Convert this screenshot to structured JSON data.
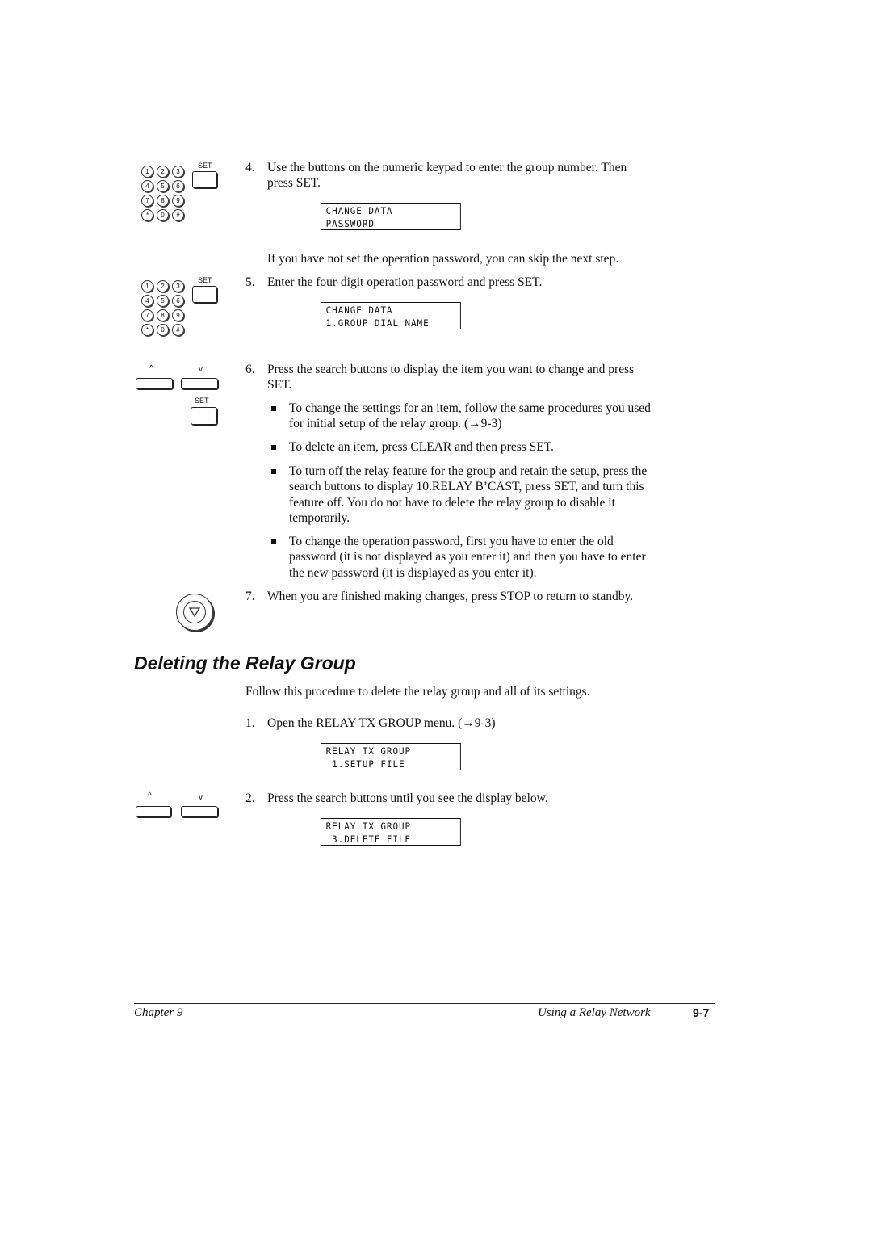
{
  "keypad_keys": [
    "1",
    "2",
    "3",
    "4",
    "5",
    "6",
    "7",
    "8",
    "9",
    "*",
    "0",
    "#"
  ],
  "icons": {
    "set_label": "SET",
    "up_label": "^",
    "down_label": "v",
    "stop": "stop-button-icon",
    "keypad": "numeric-keypad-icon"
  },
  "steps_top": [
    {
      "num": "4.",
      "lines": [
        "Use the buttons on the numeric keypad to enter the group number. Then",
        "press SET."
      ]
    },
    {
      "para": "If you have not set the operation password, you can skip the next step."
    },
    {
      "num": "5.",
      "lines": [
        "Enter the four-digit operation password and press SET."
      ]
    },
    {
      "num": "6.",
      "lines": [
        "Press the search buttons to display the item you want to change and press",
        "SET."
      ]
    },
    {
      "num": "7.",
      "lines": [
        "When you are finished making changes, press STOP to return to standby."
      ]
    }
  ],
  "bullets": [
    [
      "To change the settings for an item, follow the same procedures you used",
      "for initial setup of the relay group. (→9-3)"
    ],
    [
      "To delete an item, press CLEAR and then press SET."
    ],
    [
      "To turn off the relay feature for the group and retain the setup, press the",
      "search buttons to display 10.RELAY B’CAST, press SET, and turn this",
      "feature off. You do not have to delete the relay group to disable it",
      "temporarily."
    ],
    [
      "To change the operation password, first you have to enter the old",
      "password (it is not displayed as you enter it) and then you have to enter",
      "the new password (it is displayed as you enter it)."
    ]
  ],
  "lcd": [
    [
      "CHANGE DATA",
      "PASSWORD        _"
    ],
    [
      "CHANGE DATA",
      "1.GROUP DIAL NAME"
    ],
    [
      "RELAY TX GROUP",
      " 1.SETUP FILE"
    ],
    [
      "RELAY TX GROUP",
      " 3.DELETE FILE"
    ]
  ],
  "section": {
    "heading": "Deleting the Relay Group",
    "intro": "Follow this procedure to delete the relay group and all of its settings.",
    "steps": [
      {
        "num": "1.",
        "text": "Open the RELAY TX GROUP menu. (→9-3)"
      },
      {
        "num": "2.",
        "text": "Press the search buttons until you see the display below."
      }
    ]
  },
  "footer": {
    "chapter": "Chapter 9",
    "title": "Using a Relay Network",
    "page": "9-7"
  }
}
